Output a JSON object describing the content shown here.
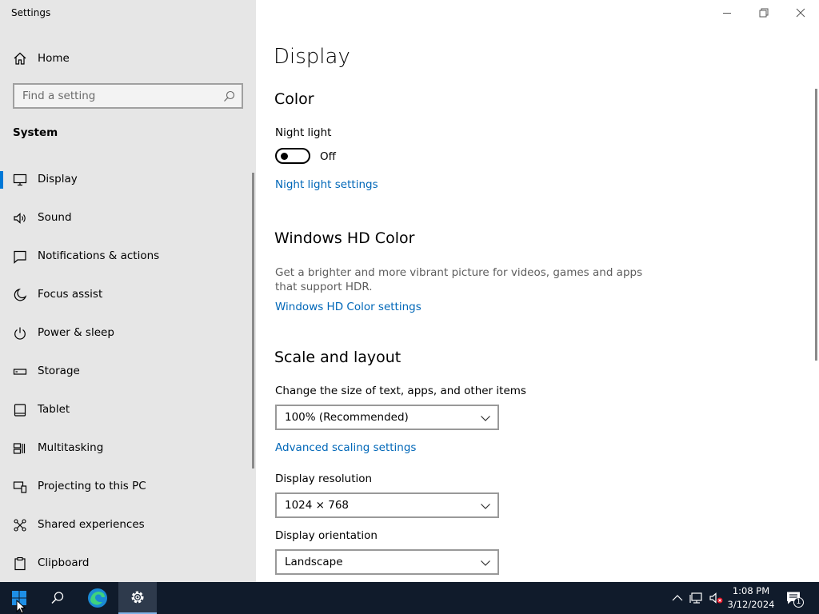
{
  "window": {
    "title": "Settings"
  },
  "sidebar": {
    "home_label": "Home",
    "search_placeholder": "Find a setting",
    "section_title": "System",
    "items": [
      {
        "label": "Display",
        "icon": "monitor-icon",
        "active": true
      },
      {
        "label": "Sound",
        "icon": "speaker-icon"
      },
      {
        "label": "Notifications & actions",
        "icon": "message-icon"
      },
      {
        "label": "Focus assist",
        "icon": "moon-icon"
      },
      {
        "label": "Power & sleep",
        "icon": "power-icon"
      },
      {
        "label": "Storage",
        "icon": "storage-icon"
      },
      {
        "label": "Tablet",
        "icon": "tablet-icon"
      },
      {
        "label": "Multitasking",
        "icon": "multitasking-icon"
      },
      {
        "label": "Projecting to this PC",
        "icon": "projecting-icon"
      },
      {
        "label": "Shared experiences",
        "icon": "share-icon"
      },
      {
        "label": "Clipboard",
        "icon": "clipboard-icon"
      }
    ]
  },
  "main": {
    "page_title": "Display",
    "color": {
      "heading": "Color",
      "night_light_label": "Night light",
      "night_light_state": "Off",
      "night_light_link": "Night light settings"
    },
    "hd_color": {
      "heading": "Windows HD Color",
      "description": "Get a brighter and more vibrant picture for videos, games and apps that support HDR.",
      "link": "Windows HD Color settings"
    },
    "scale": {
      "heading": "Scale and layout",
      "size_label": "Change the size of text, apps, and other items",
      "size_value": "100% (Recommended)",
      "advanced_link": "Advanced scaling settings",
      "resolution_label": "Display resolution",
      "resolution_value": "1024 × 768",
      "orientation_label": "Display orientation",
      "orientation_value": "Landscape"
    }
  },
  "taskbar": {
    "time": "1:08 PM",
    "date": "3/12/2024",
    "notification_count": "1"
  },
  "colors": {
    "accent": "#0078d7",
    "link": "#0067b8",
    "sidebar_bg": "#e6e6e6",
    "taskbar_bg": "#101b2b"
  }
}
